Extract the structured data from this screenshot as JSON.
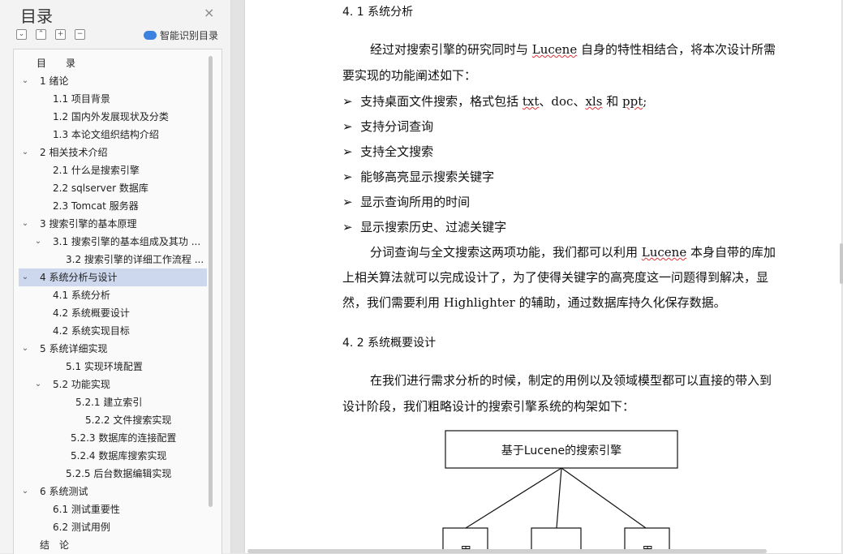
{
  "toc": {
    "title": "目录",
    "close_icon": "×",
    "smart_label": "智能识别目录",
    "items": [
      {
        "label": "目　　录",
        "indent": 0,
        "arrow": ""
      },
      {
        "label": "1  绪论",
        "indent": 1,
        "arrow": "v"
      },
      {
        "label": "1.1  项目背景",
        "indent": 2,
        "arrow": ""
      },
      {
        "label": "1.2  国内外发展现状及分类",
        "indent": 2,
        "arrow": ""
      },
      {
        "label": "1.3  本论文组织结构介绍",
        "indent": 2,
        "arrow": ""
      },
      {
        "label": "2  相关技术介绍",
        "indent": 1,
        "arrow": "v"
      },
      {
        "label": "2.1 什么是搜索引擎",
        "indent": 2,
        "arrow": ""
      },
      {
        "label": "2.2    sqlserver 数据库",
        "indent": 2,
        "arrow": ""
      },
      {
        "label": "2.3 Tomcat 服务器",
        "indent": 2,
        "arrow": ""
      },
      {
        "label": "3  搜索引擎的基本原理",
        "indent": 1,
        "arrow": "v"
      },
      {
        "label": "3.1 搜索引擎的基本组成及其功 ...",
        "indent": 2,
        "arrow": "v"
      },
      {
        "label": "3.2 搜索引擎的详细工作流程  ...",
        "indent": 3,
        "arrow": ""
      },
      {
        "label": "4  系统分析与设计",
        "indent": 1,
        "arrow": "v",
        "active": true
      },
      {
        "label": "4.1 系统分析",
        "indent": 2,
        "arrow": ""
      },
      {
        "label": "4.2 系统概要设计",
        "indent": 2,
        "arrow": ""
      },
      {
        "label": "4.2 系统实现目标",
        "indent": 2,
        "arrow": ""
      },
      {
        "label": "5  系统详细实现",
        "indent": 1,
        "arrow": "v"
      },
      {
        "label": "5.1 实现环境配置",
        "indent": 3,
        "arrow": ""
      },
      {
        "label": "5.2 功能实现",
        "indent": 2,
        "arrow": "v"
      },
      {
        "label": "5.2.1    建立索引",
        "indent": 4,
        "arrow": ""
      },
      {
        "label": "5.2.2    文件搜索实现",
        "indent": 5,
        "arrow": ""
      },
      {
        "label": "5.2.3    数据库的连接配置",
        "indent": 3.5,
        "arrow": ""
      },
      {
        "label": "5.2.4    数据库搜索实现",
        "indent": 3.5,
        "arrow": ""
      },
      {
        "label": "5.2.5    后台数据编辑实现",
        "indent": 3,
        "arrow": ""
      },
      {
        "label": "6  系统测试",
        "indent": 1,
        "arrow": "v"
      },
      {
        "label": "6.1 测试重要性",
        "indent": 2,
        "arrow": ""
      },
      {
        "label": "6.2 测试用例",
        "indent": 2,
        "arrow": ""
      },
      {
        "label": "结　论",
        "indent": 0,
        "arrow": ""
      }
    ]
  },
  "doc": {
    "h41": "4. 1 系统分析",
    "p1_line1_a": "经过对搜索引擎的研究同时与 ",
    "p1_lucene": "Lucene",
    "p1_line1_b": " 自身的特性相结合，将本次设计所需",
    "p1_line2": "要实现的功能阐述如下：",
    "bullet_mark": "➢",
    "b1_a": "支持桌面文件搜索，格式包括 ",
    "b1_txt": "txt",
    "b1_sep1": "、doc、",
    "b1_xls": "xls",
    "b1_and": " 和 ",
    "b1_ppt": "ppt",
    "b1_end": ";",
    "b2": "支持分词查询",
    "b3": "支持全文搜索",
    "b4": "能够高亮显示搜索关键字",
    "b5": "显示查询所用的时间",
    "b6": "显示搜索历史、过滤关键字",
    "p2_line1_a": "分词查询与全文搜索这两项功能，我们都可以利用 ",
    "p2_lucene": "Lucene",
    "p2_line1_b": " 本身自带的库加",
    "p2_line2": "上相关算法就可以完成设计了，为了使得关键字的高亮度这一问题得到解决，显",
    "p2_line3": "然，我们需要利用 Highlighter 的辅助，通过数据库持久化保存数据。",
    "h42": "4. 2 系统概要设计",
    "p3_line1": "在我们进行需求分析的时候，制定的用例以及领域模型都可以直接的带入到",
    "p3_line2": "设计阶段，我们粗略设计的搜索引擎系统的构架如下：",
    "diagram_root": "基于Lucene的搜索引擎",
    "diagram_child1": "用",
    "diagram_child3": "用"
  }
}
